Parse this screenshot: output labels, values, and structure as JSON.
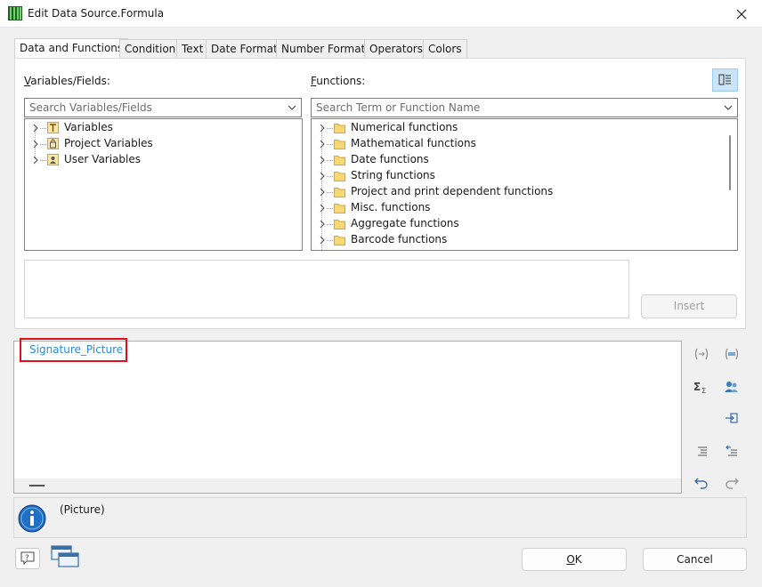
{
  "window": {
    "title": "Edit Data Source.Formula"
  },
  "tabs": [
    {
      "label": "Data and Functions"
    },
    {
      "label": "Condition"
    },
    {
      "label": "Text"
    },
    {
      "label": "Date Format"
    },
    {
      "label": "Number Format"
    },
    {
      "label": "Operators"
    },
    {
      "label": "Colors"
    }
  ],
  "variables": {
    "label_mnemonic": "V",
    "label_rest": "ariables/Fields:",
    "search_placeholder": "Search Variables/Fields",
    "items": [
      {
        "label": "Variables",
        "icon": "text-variable-icon"
      },
      {
        "label": "Project Variables",
        "icon": "project-variable-icon"
      },
      {
        "label": "User Variables",
        "icon": "user-variable-icon"
      }
    ]
  },
  "functions": {
    "label_mnemonic": "F",
    "label_rest": "unctions:",
    "search_placeholder": "Search Term or Function Name",
    "items": [
      {
        "label": "Numerical functions"
      },
      {
        "label": "Mathematical functions"
      },
      {
        "label": "Date functions"
      },
      {
        "label": "String functions"
      },
      {
        "label": "Project and print dependent functions"
      },
      {
        "label": "Misc. functions"
      },
      {
        "label": "Aggregate functions"
      },
      {
        "label": "Barcode functions"
      }
    ]
  },
  "buttons": {
    "insert": "Insert",
    "ok_mnemonic": "O",
    "ok_rest": "K",
    "cancel": "Cancel"
  },
  "editor": {
    "text": "Signature_Picture"
  },
  "info": {
    "text": "(Picture)"
  },
  "colors": {
    "accent": "#2b8cd6",
    "highlight": "#e0101a",
    "folder": "#f8d775"
  }
}
